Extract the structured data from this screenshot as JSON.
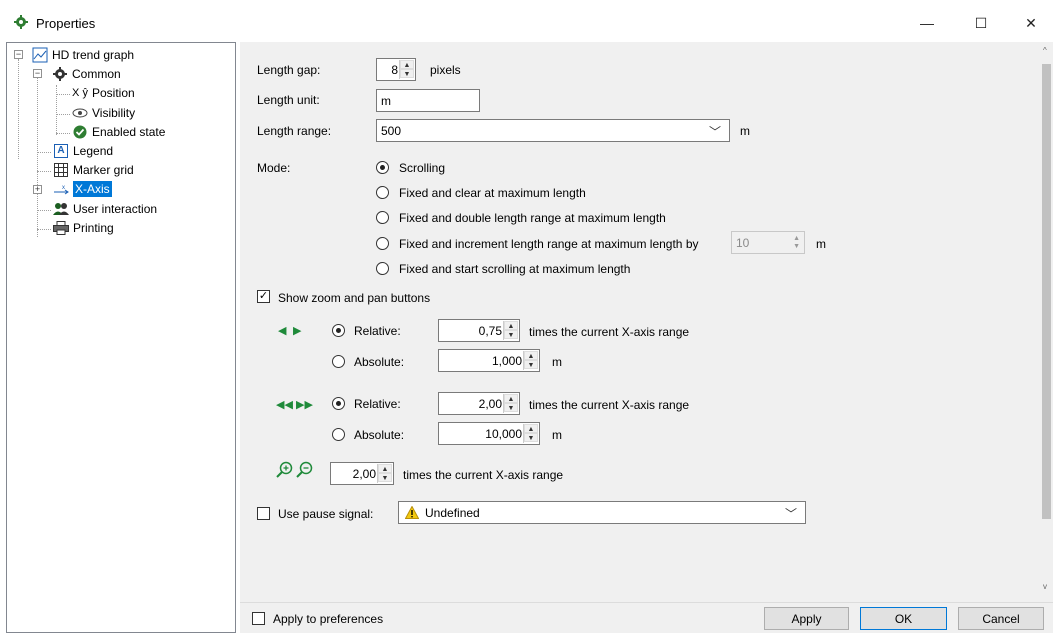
{
  "window": {
    "title": "Properties",
    "minimize": "—",
    "maximize": "☐",
    "close": "✕"
  },
  "tree": {
    "root": "HD trend graph",
    "common": "Common",
    "position": "Position",
    "position_icon_text": "X ŷ",
    "visibility": "Visibility",
    "enabled_state": "Enabled state",
    "legend": "Legend",
    "legend_icon_text": "A",
    "marker_grid": "Marker grid",
    "x_axis": "X-Axis",
    "user_interaction": "User interaction",
    "printing": "Printing"
  },
  "form": {
    "length_gap_label": "Length gap:",
    "length_gap_value": "8",
    "length_gap_unit": "pixels",
    "length_unit_label": "Length unit:",
    "length_unit_value": "m",
    "length_range_label": "Length range:",
    "length_range_value": "500",
    "length_range_unit": "m",
    "mode_label": "Mode:",
    "modes": [
      "Scrolling",
      "Fixed and clear at maximum length",
      "Fixed and double length range at maximum length",
      "Fixed and increment length range at maximum length by",
      "Fixed and start scrolling at maximum length"
    ],
    "mode_selected": "Scrolling",
    "increment_value": "10",
    "increment_unit": "m",
    "show_zoom_label": "Show zoom and pan buttons",
    "show_zoom_checked": true,
    "pan1": {
      "relative_label": "Relative:",
      "relative_value": "0,75",
      "relative_suffix": "times the current X-axis range",
      "absolute_label": "Absolute:",
      "absolute_value": "1,000",
      "absolute_unit": "m"
    },
    "pan2": {
      "relative_label": "Relative:",
      "relative_value": "2,00",
      "relative_suffix": "times the current X-axis range",
      "absolute_label": "Absolute:",
      "absolute_value": "10,000",
      "absolute_unit": "m"
    },
    "zoom_value": "2,00",
    "zoom_suffix": "times the current X-axis range",
    "pause_label": "Use pause signal:",
    "pause_checked": false,
    "pause_value": "Undefined"
  },
  "footer": {
    "apply_prefs_label": "Apply to preferences",
    "apply": "Apply",
    "ok": "OK",
    "cancel": "Cancel"
  },
  "colors": {
    "accent": "#0078d7",
    "green": "#1f8a3a",
    "warning": "#f2c811"
  }
}
